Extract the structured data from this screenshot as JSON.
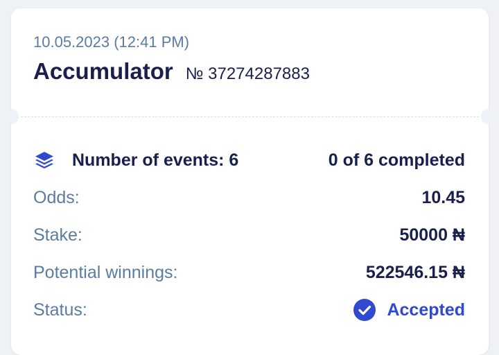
{
  "ticket": {
    "date": "10.05.2023 (12:41 PM)",
    "bet_type": "Accumulator",
    "bet_number": "№ 37274287883"
  },
  "events": {
    "label": "Number of events: 6",
    "progress": "0 of 6 completed",
    "icon": "layers-icon"
  },
  "odds": {
    "label": "Odds:",
    "value": "10.45"
  },
  "stake": {
    "label": "Stake:",
    "value": "50000 ₦"
  },
  "winnings": {
    "label": "Potential winnings:",
    "value": "522546.15 ₦"
  },
  "status": {
    "label": "Status:",
    "value": "Accepted",
    "icon": "check-circle-icon"
  },
  "colors": {
    "background": "#eef1f6",
    "card": "#ffffff",
    "primary_text": "#1a1f4e",
    "label_text": "#5a7ba3",
    "accent": "#2f49d1"
  }
}
